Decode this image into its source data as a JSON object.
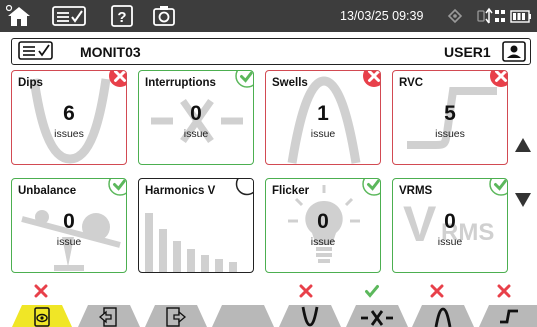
{
  "status": {
    "datetime": "13/03/25 09:39"
  },
  "header": {
    "title": "MONIT03",
    "user": "USER1"
  },
  "tiles": [
    {
      "name": "dips",
      "title": "Dips",
      "count": "6",
      "unit": "issues",
      "state": "error"
    },
    {
      "name": "interruptions",
      "title": "Interruptions",
      "count": "0",
      "unit": "issue",
      "state": "ok"
    },
    {
      "name": "swells",
      "title": "Swells",
      "count": "1",
      "unit": "issue",
      "state": "error"
    },
    {
      "name": "rvc",
      "title": "RVC",
      "count": "5",
      "unit": "issues",
      "state": "error"
    },
    {
      "name": "unbalance",
      "title": "Unbalance",
      "count": "0",
      "unit": "issue",
      "state": "ok"
    },
    {
      "name": "harmonics-v",
      "title": "Harmonics V",
      "count": "",
      "unit": "",
      "state": "none"
    },
    {
      "name": "flicker",
      "title": "Flicker",
      "count": "0",
      "unit": "issue",
      "state": "ok"
    },
    {
      "name": "vrms",
      "title": "VRMS",
      "count": "0",
      "unit": "issue",
      "state": "ok"
    }
  ],
  "vrms_watermark": {
    "big": "V",
    "small": "RMS"
  },
  "bottom_tabs": [
    {
      "name": "view",
      "icon": "eye-icon",
      "status": "error",
      "active": true
    },
    {
      "name": "previous",
      "icon": "previous-page-icon",
      "status": "none",
      "active": false
    },
    {
      "name": "next",
      "icon": "next-page-icon",
      "status": "none",
      "active": false
    },
    {
      "name": "blank",
      "icon": "",
      "status": "none",
      "active": false
    },
    {
      "name": "dips",
      "icon": "dip-waveform-icon",
      "status": "error",
      "active": false
    },
    {
      "name": "interruptions",
      "icon": "interruption-waveform-icon",
      "status": "ok",
      "active": false
    },
    {
      "name": "swells",
      "icon": "swell-waveform-icon",
      "status": "error",
      "active": false
    },
    {
      "name": "rvc",
      "icon": "rvc-step-icon",
      "status": "error",
      "active": false
    }
  ],
  "colors": {
    "error": "#e8404a",
    "ok": "#5cb85c",
    "active_tab": "#f0e626",
    "status_bar": "#3d3d3d",
    "watermark": "#cccccc"
  }
}
